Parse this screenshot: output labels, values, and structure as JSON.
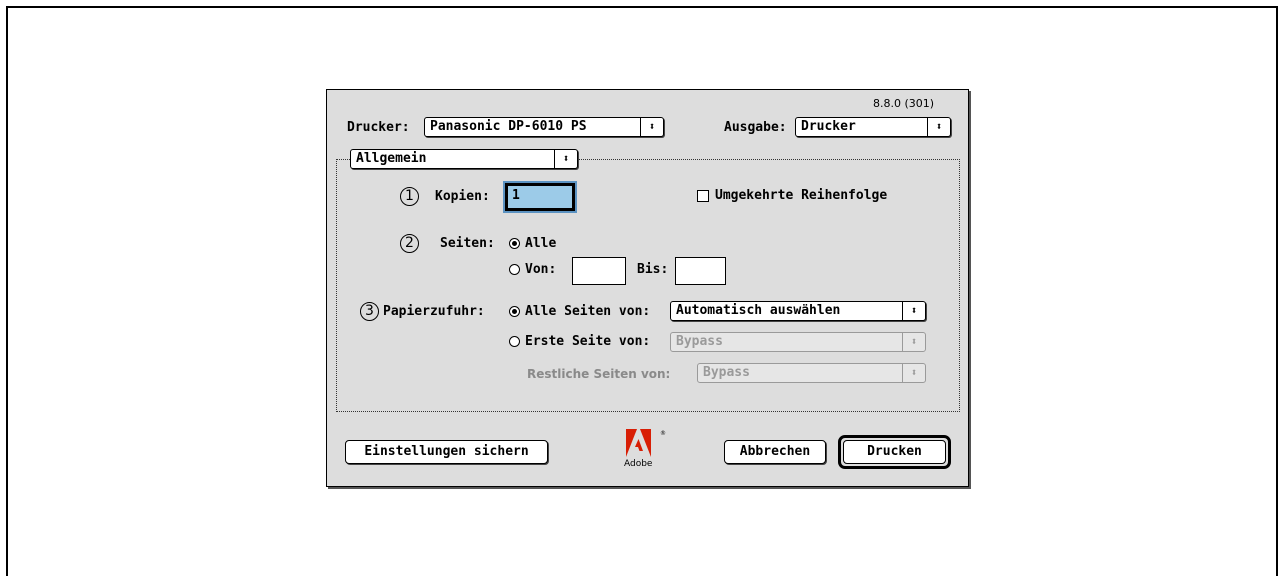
{
  "version": "8.8.0 (301)",
  "printer": {
    "label": "Drucker:",
    "value": "Panasonic DP-6010 PS"
  },
  "output": {
    "label": "Ausgabe:",
    "value": "Drucker"
  },
  "panel": {
    "value": "Allgemein"
  },
  "markers": [
    "1",
    "2",
    "3"
  ],
  "copies": {
    "label": "Kopien:",
    "value": "1"
  },
  "reverse_order": {
    "label": "Umgekehrte Reihenfolge",
    "checked": false
  },
  "pages": {
    "label": "Seiten:",
    "all_label": "Alle",
    "from_label": "Von:",
    "to_label": "Bis:",
    "from_value": "",
    "to_value": "",
    "selected": "all"
  },
  "paper_source": {
    "label": "Papierzufuhr:",
    "all_pages_label": "Alle Seiten von:",
    "all_pages_value": "Automatisch auswählen",
    "first_page_label": "Erste Seite von:",
    "first_page_value": "Bypass",
    "remaining_label": "Restliche Seiten von:",
    "remaining_value": "Bypass",
    "selected": "all"
  },
  "buttons": {
    "save_settings": "Einstellungen sichern",
    "cancel": "Abbrechen",
    "print": "Drucken"
  },
  "logo": {
    "text": "Adobe",
    "registered": "®",
    "color": "#d81e05"
  },
  "icons": {
    "popup_arrows": "⬍"
  }
}
